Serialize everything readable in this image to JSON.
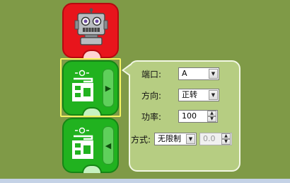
{
  "blocks": {
    "robot": {
      "icon": "robot-icon"
    },
    "motor1": {
      "icon": "motor-icon",
      "toggle_icon": "chevron-right-icon"
    },
    "motor2": {
      "icon": "motor-icon",
      "toggle_icon": "chevron-left-icon"
    }
  },
  "popup": {
    "port": {
      "label": "端口:",
      "value": "A"
    },
    "direction": {
      "label": "方向:",
      "value": "正转"
    },
    "power": {
      "label": "功率:",
      "value": "100"
    },
    "mode": {
      "label": "方式:",
      "value": "无限制",
      "duration_value": "0.0"
    }
  },
  "colors": {
    "canvas": "#7f9a47",
    "robot_block": "#e8151c",
    "motor_block": "#21b21f",
    "popup_bg": "#b6cd82",
    "selection": "#f4f460"
  }
}
